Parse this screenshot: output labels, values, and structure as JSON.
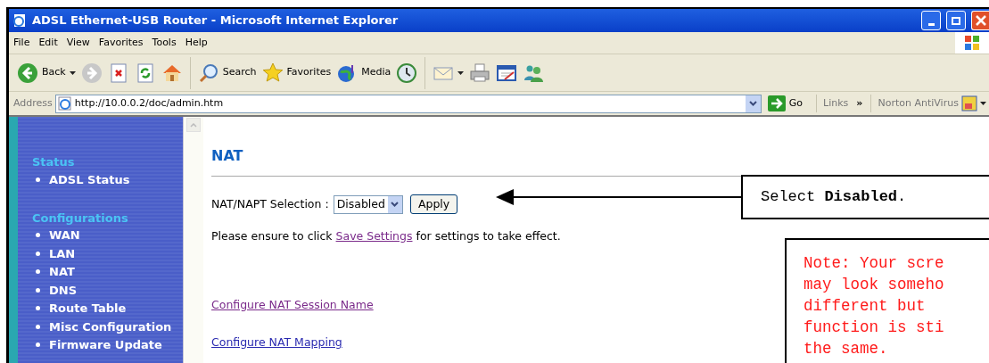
{
  "window": {
    "title": "ADSL Ethernet-USB Router - Microsoft Internet Explorer"
  },
  "menu": [
    "File",
    "Edit",
    "View",
    "Favorites",
    "Tools",
    "Help"
  ],
  "toolbar": [
    {
      "kind": "back",
      "label": "Back"
    },
    {
      "kind": "forward"
    },
    {
      "kind": "stop"
    },
    {
      "kind": "refresh"
    },
    {
      "kind": "home"
    },
    {
      "kind": "search",
      "label": "Search"
    },
    {
      "kind": "favorites",
      "label": "Favorites"
    },
    {
      "kind": "media",
      "label": "Media"
    },
    {
      "kind": "history"
    },
    {
      "kind": "mail"
    },
    {
      "kind": "print"
    },
    {
      "kind": "edit"
    },
    {
      "kind": "messenger"
    }
  ],
  "address_bar": {
    "label": "Address",
    "value": "http://10.0.0.2/doc/admin.htm",
    "go": "Go",
    "links": "Links",
    "chevron": "»",
    "norton": "Norton AntiVirus"
  },
  "sidebar": {
    "sections": [
      {
        "title": "Status",
        "items": [
          "ADSL Status"
        ]
      },
      {
        "title": "Configurations",
        "items": [
          "WAN",
          "LAN",
          "NAT",
          "DNS",
          "Route Table",
          "Misc Configuration",
          "Firmware Update"
        ]
      }
    ]
  },
  "page": {
    "heading": "NAT",
    "selection_label": "NAT/NAPT Selection :",
    "select_value": "Disabled",
    "apply": "Apply",
    "notice_before": "Please ensure to click",
    "notice_link": {
      "text": "Save Settings",
      "visited": true
    },
    "notice_after": "for settings to take effect.",
    "links": [
      {
        "text": "Configure NAT Session Name",
        "visited": true
      },
      {
        "text": "Configure NAT Mapping",
        "visited": false
      }
    ]
  },
  "callouts": {
    "instruction": "Select **Disabled**.",
    "note": [
      "Note: Your scre",
      "may look someho",
      "different but",
      "function is sti",
      "the same."
    ]
  }
}
